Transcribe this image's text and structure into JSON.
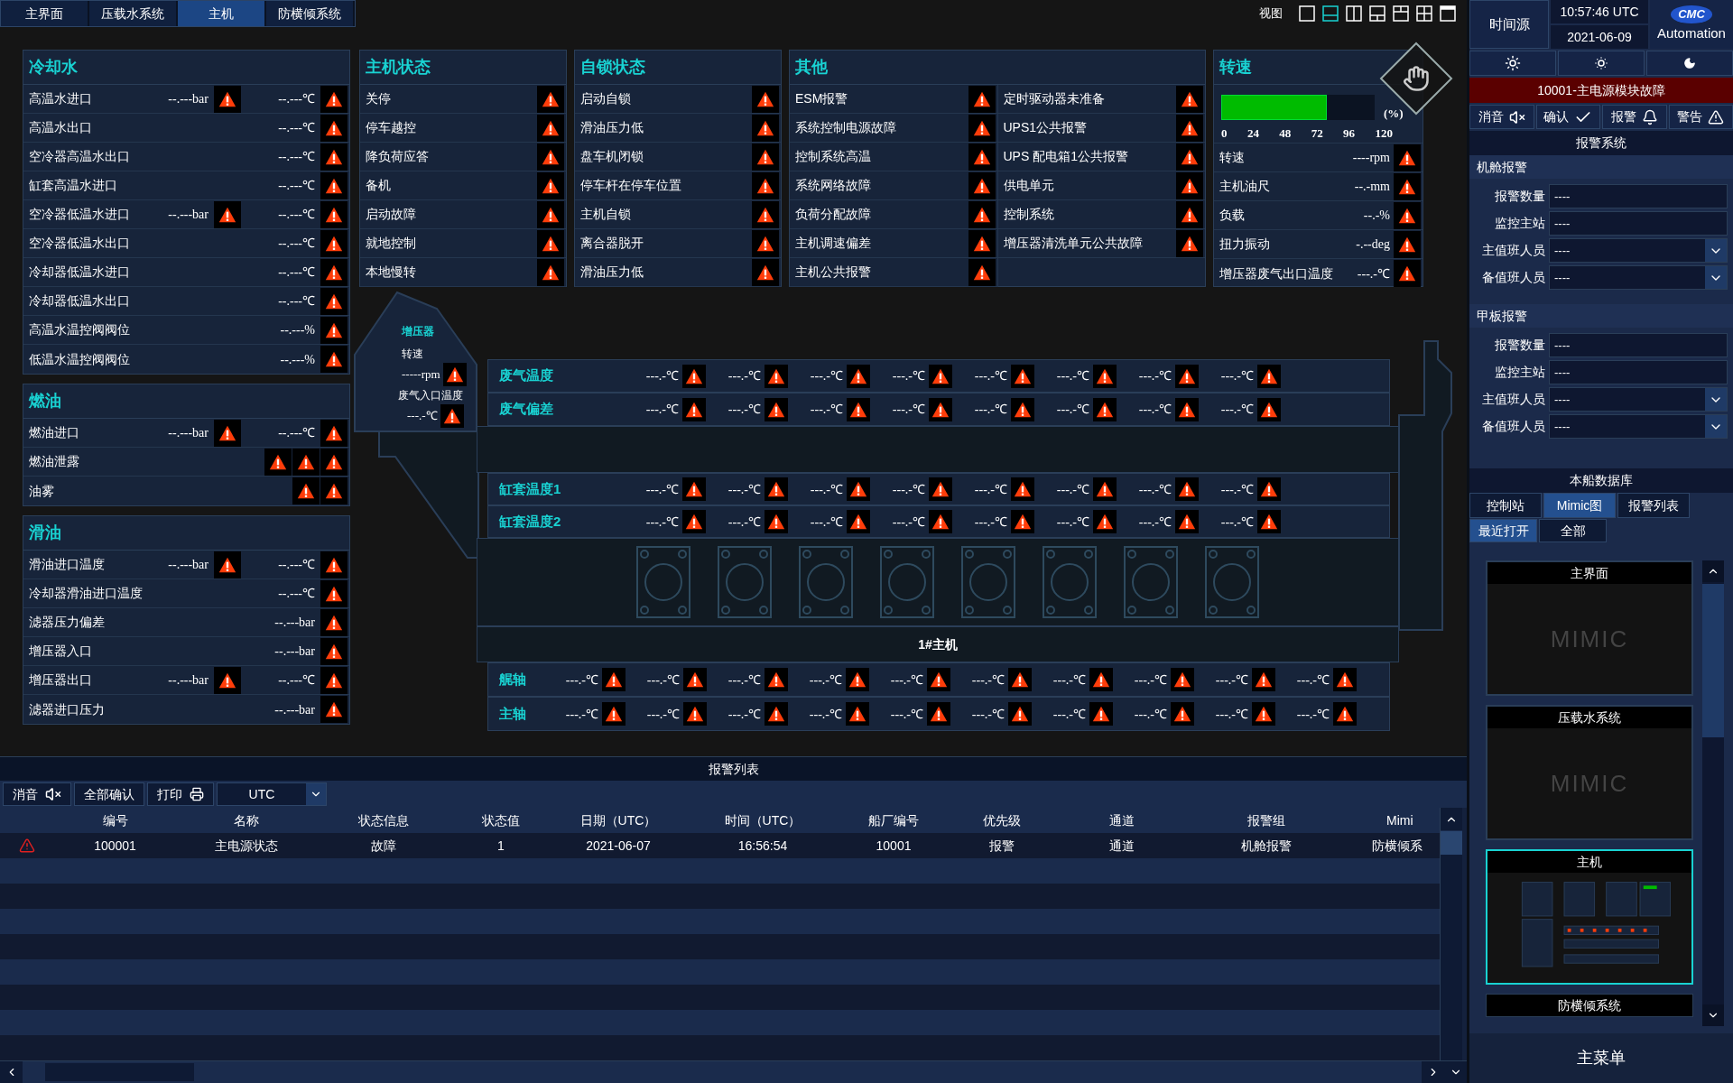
{
  "nav_tabs": [
    {
      "label": "主界面",
      "selected": false
    },
    {
      "label": "压载水系统",
      "selected": false
    },
    {
      "label": "主机",
      "selected": true
    },
    {
      "label": "防横倾系统",
      "selected": false
    }
  ],
  "view": {
    "label": "视图",
    "layouts": [
      {
        "kind": "single",
        "selected": false
      },
      {
        "kind": "bottom",
        "selected": true
      },
      {
        "kind": "columns",
        "selected": false
      },
      {
        "kind": "bottom-split",
        "selected": false
      },
      {
        "kind": "top-split",
        "selected": false
      },
      {
        "kind": "quad",
        "selected": false
      },
      {
        "kind": "top",
        "selected": false
      }
    ]
  },
  "left_panels": [
    {
      "title": "冷却水",
      "rows": [
        {
          "label": "高温水进口",
          "cells": [
            {
              "kind": "reading",
              "value": "--.---bar"
            },
            {
              "kind": "reading",
              "value": "--.---℃"
            }
          ]
        },
        {
          "label": "高温水出口",
          "cells": [
            {
              "kind": "reading",
              "value": "--.---℃"
            }
          ]
        },
        {
          "label": "空冷器高温水出口",
          "cells": [
            {
              "kind": "reading",
              "value": "--.---℃"
            }
          ]
        },
        {
          "label": "缸套高温水进口",
          "cells": [
            {
              "kind": "reading",
              "value": "--.---℃"
            }
          ]
        },
        {
          "label": "空冷器低温水进口",
          "cells": [
            {
              "kind": "reading",
              "value": "--.---bar"
            },
            {
              "kind": "reading",
              "value": "--.---℃"
            }
          ]
        },
        {
          "label": "空冷器低温水出口",
          "cells": [
            {
              "kind": "reading",
              "value": "--.---℃"
            }
          ]
        },
        {
          "label": "冷却器低温水进口",
          "cells": [
            {
              "kind": "reading",
              "value": "--.---℃"
            }
          ]
        },
        {
          "label": "冷却器低温水出口",
          "cells": [
            {
              "kind": "reading",
              "value": "--.---℃"
            }
          ]
        },
        {
          "label": "高温水温控阀阀位",
          "cells": [
            {
              "kind": "reading",
              "value": "--.---%"
            }
          ]
        },
        {
          "label": "低温水温控阀阀位",
          "cells": [
            {
              "kind": "reading",
              "value": "--.---%"
            }
          ]
        }
      ]
    },
    {
      "title": "燃油",
      "rows": [
        {
          "label": "燃油进口",
          "cells": [
            {
              "kind": "reading",
              "value": "--.---bar"
            },
            {
              "kind": "reading",
              "value": "--.---℃"
            }
          ]
        },
        {
          "label": "燃油泄露",
          "cells": [
            {
              "kind": "alarm"
            },
            {
              "kind": "alarm"
            },
            {
              "kind": "alarm"
            }
          ]
        },
        {
          "label": "油雾",
          "cells": [
            {
              "kind": "alarm"
            },
            {
              "kind": "alarm"
            }
          ]
        }
      ]
    },
    {
      "title": "滑油",
      "rows": [
        {
          "label": "滑油进口温度",
          "cells": [
            {
              "kind": "reading",
              "value": "--.---bar"
            },
            {
              "kind": "reading",
              "value": "--.---℃"
            }
          ]
        },
        {
          "label": "冷却器滑油进口温度",
          "cells": [
            {
              "kind": "reading",
              "value": "--.---℃"
            }
          ]
        },
        {
          "label": "滤器压力偏差",
          "cells": [
            {
              "kind": "reading",
              "value": "--.---bar"
            }
          ]
        },
        {
          "label": "增压器入口",
          "cells": [
            {
              "kind": "reading",
              "value": "--.---bar"
            }
          ]
        },
        {
          "label": "增压器出口",
          "cells": [
            {
              "kind": "reading",
              "value": "--.---bar"
            },
            {
              "kind": "reading",
              "value": "--.---℃"
            }
          ]
        },
        {
          "label": "滤器进口压力",
          "cells": [
            {
              "kind": "reading",
              "value": "--.---bar"
            }
          ]
        }
      ]
    }
  ],
  "status_panels": [
    {
      "title": "主机状态",
      "columns": [
        [
          "关停",
          "停车越控",
          "降负荷应答",
          "备机",
          "启动故障",
          "就地控制",
          "本地慢转"
        ]
      ]
    },
    {
      "title": "自锁状态",
      "columns": [
        [
          "启动自锁",
          "滑油压力低",
          "盘车机闭锁",
          "停车杆在停车位置",
          "主机自锁",
          "离合器脱开",
          "滑油压力低"
        ]
      ]
    },
    {
      "title": "其他",
      "columns": [
        [
          "ESM报警",
          "系统控制电源故障",
          "控制系统高温",
          "系统网络故障",
          "负荷分配故障",
          "主机调速偏差",
          "主机公共报警"
        ],
        [
          "定时驱动器未准备",
          "UPS1公共报警",
          "UPS 配电箱1公共报警",
          "供电单元",
          "控制系统",
          "增压器清洗单元公共故障"
        ]
      ]
    }
  ],
  "speed": {
    "title": "转速",
    "gauge": {
      "level": 0.69,
      "ticks": [
        "0",
        "24",
        "48",
        "72",
        "96",
        "120"
      ],
      "unit": "(%)"
    },
    "rows": [
      {
        "label": "转速",
        "value": "----rpm"
      },
      {
        "label": "主机油尺",
        "value": "--.-mm"
      },
      {
        "label": "负载",
        "value": "--.-%"
      },
      {
        "label": "扭力振动",
        "value": "-.--deg"
      },
      {
        "label": "增压器废气出口温度",
        "value": "---.-℃"
      }
    ]
  },
  "turbocharger": {
    "title": "增压器",
    "speed_label": "转速",
    "speed_value": "-----rpm",
    "exhaust_label": "废气入口温度",
    "exhaust_value": "---.-℃"
  },
  "engine": {
    "name": "1#主机",
    "upper_rows": [
      {
        "label": "废气温度",
        "values": [
          "---.-℃",
          "---.-℃",
          "---.-℃",
          "---.-℃",
          "---.-℃",
          "---.-℃",
          "---.-℃",
          "---.-℃"
        ]
      },
      {
        "label": "废气偏差",
        "values": [
          "---.-℃",
          "---.-℃",
          "---.-℃",
          "---.-℃",
          "---.-℃",
          "---.-℃",
          "---.-℃",
          "---.-℃"
        ]
      }
    ],
    "jacket_rows": [
      {
        "label": "缸套温度1",
        "values": [
          "---.-℃",
          "---.-℃",
          "---.-℃",
          "---.-℃",
          "---.-℃",
          "---.-℃",
          "---.-℃",
          "---.-℃"
        ]
      },
      {
        "label": "缸套温度2",
        "values": [
          "---.-℃",
          "---.-℃",
          "---.-℃",
          "---.-℃",
          "---.-℃",
          "---.-℃",
          "---.-℃",
          "---.-℃"
        ]
      }
    ],
    "shaft_rows": [
      {
        "label": "艉轴",
        "values": [
          "---.-℃",
          "---.-℃",
          "---.-℃",
          "---.-℃",
          "---.-℃",
          "---.-℃",
          "---.-℃",
          "---.-℃",
          "---.-℃",
          "---.-℃"
        ]
      },
      {
        "label": "主轴",
        "values": [
          "---.-℃",
          "---.-℃",
          "---.-℃",
          "---.-℃",
          "---.-℃",
          "---.-℃",
          "---.-℃",
          "---.-℃",
          "---.-℃",
          "---.-℃"
        ]
      }
    ]
  },
  "alarm_list": {
    "title": "报警列表",
    "toolbar": [
      {
        "label": "消音",
        "kind": "mute"
      },
      {
        "label": "全部确认",
        "kind": "plain"
      },
      {
        "label": "打印",
        "kind": "print"
      }
    ],
    "timezone": "UTC",
    "columns": [
      "编号",
      "名称",
      "状态信息",
      "状态值",
      "日期（UTC）",
      "时间（UTC）",
      "船厂编号",
      "优先级",
      "通道",
      "报警组",
      "Mimi"
    ],
    "rows": [
      {
        "cells": [
          "100001",
          "主电源状态",
          "故障",
          "1",
          "2021-06-07",
          "16:56:54",
          "10001",
          "报警",
          "通道",
          "机舱报警",
          "防横倾系"
        ]
      }
    ]
  },
  "side_panel": {
    "time_source": "时间源",
    "time": "10:57:46 UTC",
    "date": "2021-06-09",
    "logo_text": "CMC",
    "brand": "Automation",
    "active_alarm": "10001-主电源模块故障",
    "actions": [
      {
        "label": "消音",
        "kind": "mute"
      },
      {
        "label": "确认",
        "kind": "check"
      },
      {
        "label": "报警",
        "kind": "bell"
      },
      {
        "label": "警告",
        "kind": "warning"
      }
    ],
    "alarm_system": "报警系统",
    "groups": [
      {
        "title": "机舱报警",
        "fields": [
          {
            "caption": "报警数量",
            "content": "----",
            "kind": "text"
          },
          {
            "caption": "监控主站",
            "content": "----",
            "kind": "text"
          },
          {
            "caption": "主值班人员",
            "content": "----",
            "kind": "dropdown"
          },
          {
            "caption": "备值班人员",
            "content": "----",
            "kind": "dropdown"
          }
        ]
      },
      {
        "title": "甲板报警",
        "fields": [
          {
            "caption": "报警数量",
            "content": "----",
            "kind": "text"
          },
          {
            "caption": "监控主站",
            "content": "----",
            "kind": "text"
          },
          {
            "caption": "主值班人员",
            "content": "----",
            "kind": "dropdown"
          },
          {
            "caption": "备值班人员",
            "content": "----",
            "kind": "dropdown"
          }
        ]
      }
    ],
    "database": "本船数据库",
    "tabs": [
      {
        "label": "控制站",
        "selected": false
      },
      {
        "label": "Mimic图",
        "selected": true
      },
      {
        "label": "报警列表",
        "selected": false
      }
    ],
    "subtabs": [
      {
        "label": "最近打开",
        "selected": true
      },
      {
        "label": "全部",
        "selected": false
      }
    ],
    "thumbnails": [
      {
        "title": "主界面",
        "kind": "placeholder",
        "text": "MIMIC",
        "selected": false
      },
      {
        "title": "压载水系统",
        "kind": "placeholder",
        "text": "MIMIC",
        "selected": false
      },
      {
        "title": "主机",
        "kind": "preview",
        "selected": true
      },
      {
        "title": "防横倾系统",
        "kind": "cut",
        "selected": false
      }
    ],
    "main_menu": "主菜单"
  }
}
